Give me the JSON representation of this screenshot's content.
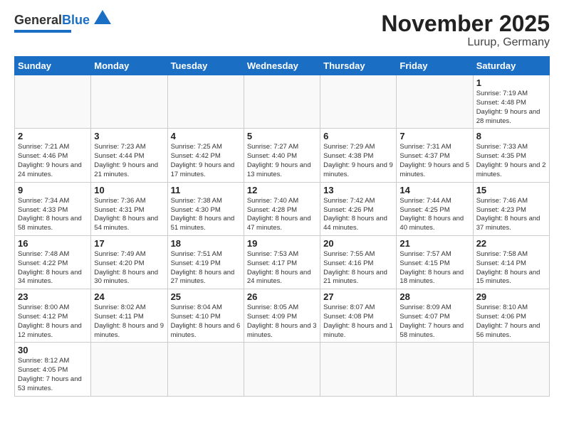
{
  "logo": {
    "text_general": "General",
    "text_blue": "Blue"
  },
  "title": "November 2025",
  "subtitle": "Lurup, Germany",
  "days_of_week": [
    "Sunday",
    "Monday",
    "Tuesday",
    "Wednesday",
    "Thursday",
    "Friday",
    "Saturday"
  ],
  "weeks": [
    [
      {
        "day": "",
        "info": ""
      },
      {
        "day": "",
        "info": ""
      },
      {
        "day": "",
        "info": ""
      },
      {
        "day": "",
        "info": ""
      },
      {
        "day": "",
        "info": ""
      },
      {
        "day": "",
        "info": ""
      },
      {
        "day": "1",
        "info": "Sunrise: 7:19 AM\nSunset: 4:48 PM\nDaylight: 9 hours\nand 28 minutes."
      }
    ],
    [
      {
        "day": "2",
        "info": "Sunrise: 7:21 AM\nSunset: 4:46 PM\nDaylight: 9 hours\nand 24 minutes."
      },
      {
        "day": "3",
        "info": "Sunrise: 7:23 AM\nSunset: 4:44 PM\nDaylight: 9 hours\nand 21 minutes."
      },
      {
        "day": "4",
        "info": "Sunrise: 7:25 AM\nSunset: 4:42 PM\nDaylight: 9 hours\nand 17 minutes."
      },
      {
        "day": "5",
        "info": "Sunrise: 7:27 AM\nSunset: 4:40 PM\nDaylight: 9 hours\nand 13 minutes."
      },
      {
        "day": "6",
        "info": "Sunrise: 7:29 AM\nSunset: 4:38 PM\nDaylight: 9 hours\nand 9 minutes."
      },
      {
        "day": "7",
        "info": "Sunrise: 7:31 AM\nSunset: 4:37 PM\nDaylight: 9 hours\nand 5 minutes."
      },
      {
        "day": "8",
        "info": "Sunrise: 7:33 AM\nSunset: 4:35 PM\nDaylight: 9 hours\nand 2 minutes."
      }
    ],
    [
      {
        "day": "9",
        "info": "Sunrise: 7:34 AM\nSunset: 4:33 PM\nDaylight: 8 hours\nand 58 minutes."
      },
      {
        "day": "10",
        "info": "Sunrise: 7:36 AM\nSunset: 4:31 PM\nDaylight: 8 hours\nand 54 minutes."
      },
      {
        "day": "11",
        "info": "Sunrise: 7:38 AM\nSunset: 4:30 PM\nDaylight: 8 hours\nand 51 minutes."
      },
      {
        "day": "12",
        "info": "Sunrise: 7:40 AM\nSunset: 4:28 PM\nDaylight: 8 hours\nand 47 minutes."
      },
      {
        "day": "13",
        "info": "Sunrise: 7:42 AM\nSunset: 4:26 PM\nDaylight: 8 hours\nand 44 minutes."
      },
      {
        "day": "14",
        "info": "Sunrise: 7:44 AM\nSunset: 4:25 PM\nDaylight: 8 hours\nand 40 minutes."
      },
      {
        "day": "15",
        "info": "Sunrise: 7:46 AM\nSunset: 4:23 PM\nDaylight: 8 hours\nand 37 minutes."
      }
    ],
    [
      {
        "day": "16",
        "info": "Sunrise: 7:48 AM\nSunset: 4:22 PM\nDaylight: 8 hours\nand 34 minutes."
      },
      {
        "day": "17",
        "info": "Sunrise: 7:49 AM\nSunset: 4:20 PM\nDaylight: 8 hours\nand 30 minutes."
      },
      {
        "day": "18",
        "info": "Sunrise: 7:51 AM\nSunset: 4:19 PM\nDaylight: 8 hours\nand 27 minutes."
      },
      {
        "day": "19",
        "info": "Sunrise: 7:53 AM\nSunset: 4:17 PM\nDaylight: 8 hours\nand 24 minutes."
      },
      {
        "day": "20",
        "info": "Sunrise: 7:55 AM\nSunset: 4:16 PM\nDaylight: 8 hours\nand 21 minutes."
      },
      {
        "day": "21",
        "info": "Sunrise: 7:57 AM\nSunset: 4:15 PM\nDaylight: 8 hours\nand 18 minutes."
      },
      {
        "day": "22",
        "info": "Sunrise: 7:58 AM\nSunset: 4:14 PM\nDaylight: 8 hours\nand 15 minutes."
      }
    ],
    [
      {
        "day": "23",
        "info": "Sunrise: 8:00 AM\nSunset: 4:12 PM\nDaylight: 8 hours\nand 12 minutes."
      },
      {
        "day": "24",
        "info": "Sunrise: 8:02 AM\nSunset: 4:11 PM\nDaylight: 8 hours\nand 9 minutes."
      },
      {
        "day": "25",
        "info": "Sunrise: 8:04 AM\nSunset: 4:10 PM\nDaylight: 8 hours\nand 6 minutes."
      },
      {
        "day": "26",
        "info": "Sunrise: 8:05 AM\nSunset: 4:09 PM\nDaylight: 8 hours\nand 3 minutes."
      },
      {
        "day": "27",
        "info": "Sunrise: 8:07 AM\nSunset: 4:08 PM\nDaylight: 8 hours\nand 1 minute."
      },
      {
        "day": "28",
        "info": "Sunrise: 8:09 AM\nSunset: 4:07 PM\nDaylight: 7 hours\nand 58 minutes."
      },
      {
        "day": "29",
        "info": "Sunrise: 8:10 AM\nSunset: 4:06 PM\nDaylight: 7 hours\nand 56 minutes."
      }
    ],
    [
      {
        "day": "30",
        "info": "Sunrise: 8:12 AM\nSunset: 4:05 PM\nDaylight: 7 hours\nand 53 minutes."
      },
      {
        "day": "",
        "info": ""
      },
      {
        "day": "",
        "info": ""
      },
      {
        "day": "",
        "info": ""
      },
      {
        "day": "",
        "info": ""
      },
      {
        "day": "",
        "info": ""
      },
      {
        "day": "",
        "info": ""
      }
    ]
  ]
}
